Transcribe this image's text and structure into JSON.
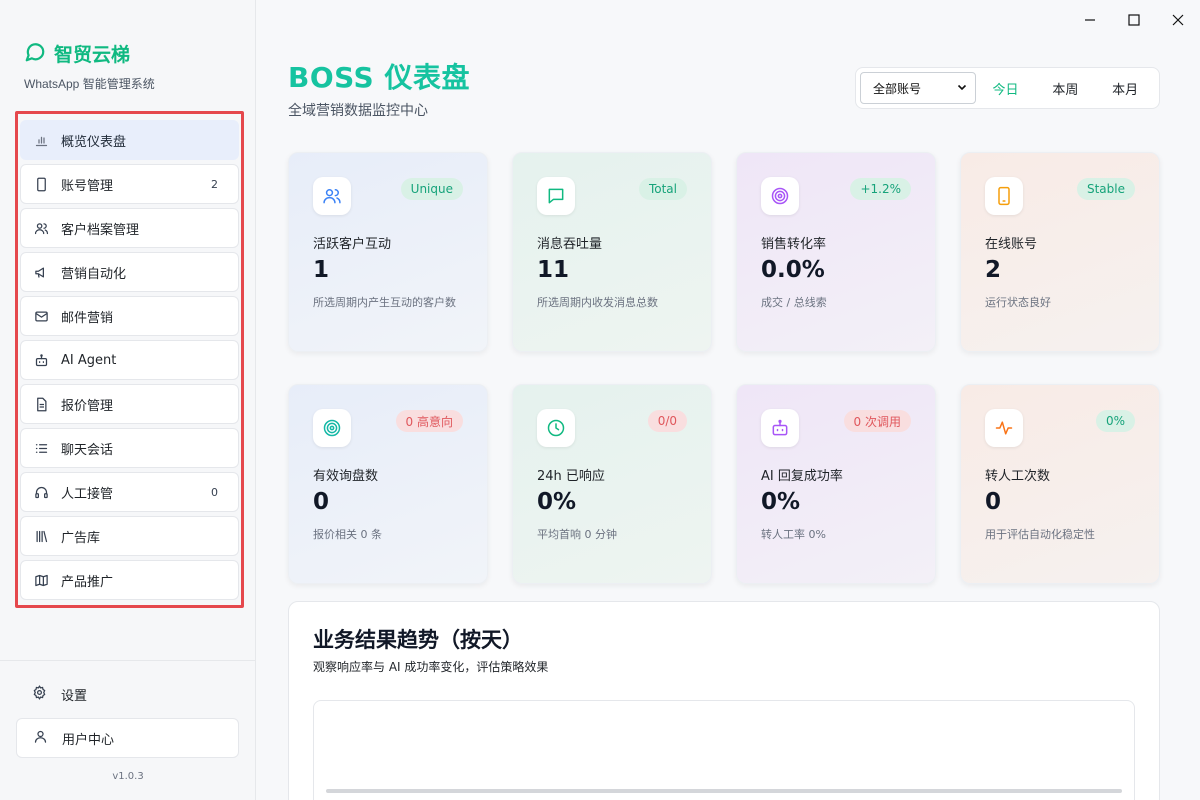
{
  "brand": {
    "title": "智贸云梯",
    "subtitle": "WhatsApp 智能管理系统",
    "accent": "#10b981"
  },
  "nav": {
    "items": [
      {
        "label": "概览仪表盘",
        "icon": "bar-chart-icon",
        "count": "",
        "active": true
      },
      {
        "label": "账号管理",
        "icon": "phone-icon",
        "count": "2"
      },
      {
        "label": "客户档案管理",
        "icon": "users-icon",
        "count": ""
      },
      {
        "label": "营销自动化",
        "icon": "megaphone-icon",
        "count": ""
      },
      {
        "label": "邮件营销",
        "icon": "mail-icon",
        "count": ""
      },
      {
        "label": "AI Agent",
        "icon": "robot-icon",
        "count": ""
      },
      {
        "label": "报价管理",
        "icon": "document-icon",
        "count": ""
      },
      {
        "label": "聊天会话",
        "icon": "list-icon",
        "count": ""
      },
      {
        "label": "人工接管",
        "icon": "headset-icon",
        "count": "0"
      },
      {
        "label": "广告库",
        "icon": "library-icon",
        "count": ""
      },
      {
        "label": "产品推广",
        "icon": "map-icon",
        "count": ""
      }
    ]
  },
  "footer": {
    "settings": "设置",
    "user_center": "用户中心",
    "version": "v1.0.3"
  },
  "header": {
    "title": "BOSS 仪表盘",
    "subtitle": "全域营销数据监控中心",
    "account_select": "全部账号",
    "ranges": [
      "今日",
      "本周",
      "本月"
    ],
    "active_range": "今日"
  },
  "metrics": [
    {
      "label": "活跃客户互动",
      "value": "1",
      "desc": "所选周期内产生互动的客户数",
      "badge": "Unique",
      "icon": "users-icon",
      "color": "#3b82f6"
    },
    {
      "label": "消息吞吐量",
      "value": "11",
      "desc": "所选周期内收发消息总数",
      "badge": "Total",
      "icon": "message-icon",
      "color": "#10b981"
    },
    {
      "label": "销售转化率",
      "value": "0.0%",
      "desc": "成交 / 总线索",
      "badge": "+1.2%",
      "icon": "target-icon",
      "color": "#a855f7"
    },
    {
      "label": "在线账号",
      "value": "2",
      "desc": "运行状态良好",
      "badge": "Stable",
      "icon": "phone-icon",
      "color": "#f59e0b"
    },
    {
      "label": "有效询盘数",
      "value": "0",
      "desc": "报价相关 0 条",
      "badge": "0 高意向",
      "icon": "target-icon",
      "color": "#14b8a6"
    },
    {
      "label": "24h 已响应",
      "value": "0%",
      "desc": "平均首响 0 分钟",
      "badge": "0/0",
      "icon": "clock-icon",
      "color": "#10b981"
    },
    {
      "label": "AI 回复成功率",
      "value": "0%",
      "desc": "转人工率 0%",
      "badge": "0 次调用",
      "icon": "robot-icon",
      "color": "#a855f7"
    },
    {
      "label": "转人工次数",
      "value": "0",
      "desc": "用于评估自动化稳定性",
      "badge": "0%",
      "icon": "activity-icon",
      "color": "#f97316"
    }
  ],
  "trend": {
    "title": "业务结果趋势（按天）",
    "subtitle": "观察响应率与 AI 成功率变化，评估策略效果"
  }
}
